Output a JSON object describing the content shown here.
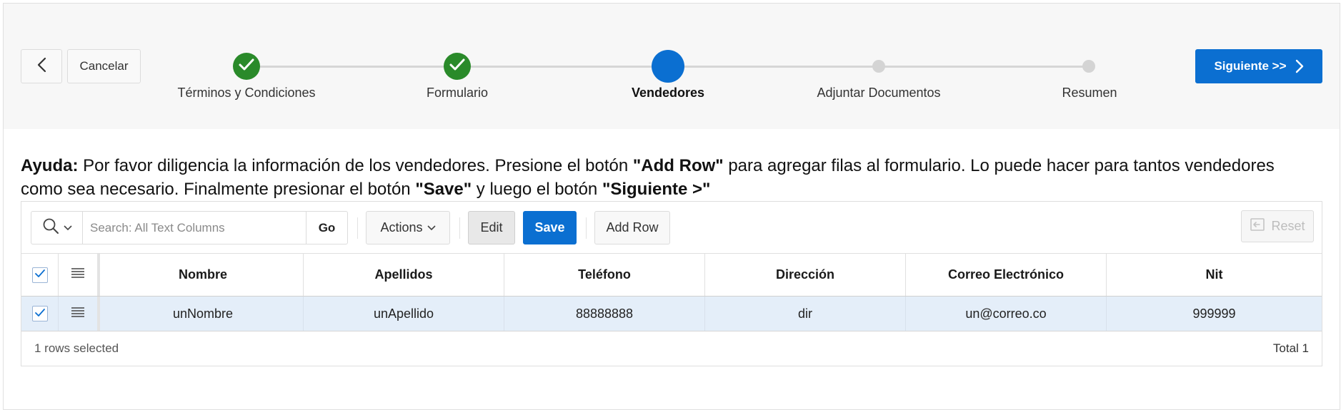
{
  "header": {
    "back_icon": "chevron-left-icon",
    "cancel_label": "Cancelar",
    "next_label": "Siguiente >>",
    "next_icon": "chevron-right-icon",
    "accent_color": "#0b6fd1",
    "done_color": "#2a8a2a"
  },
  "wizard": {
    "steps": [
      {
        "label": "Términos y Condiciones",
        "state": "done"
      },
      {
        "label": "Formulario",
        "state": "done"
      },
      {
        "label": "Vendedores",
        "state": "current"
      },
      {
        "label": "Adjuntar Documentos",
        "state": "future"
      },
      {
        "label": "Resumen",
        "state": "future"
      }
    ]
  },
  "help": {
    "prefix": "Ayuda:",
    "t1": " Por favor diligencia la información de los vendedores. Presione el botón ",
    "b1": "\"Add Row\"",
    "t2": " para agregar filas al formulario. Lo puede hacer para tantos vendedores como sea necesario. Finalmente presionar el botón ",
    "b2": "\"Save\"",
    "t3": " y luego el botón ",
    "b3": "\"Siguiente >\""
  },
  "toolbar": {
    "search_placeholder": "Search: All Text Columns",
    "go_label": "Go",
    "actions_label": "Actions",
    "edit_label": "Edit",
    "save_label": "Save",
    "add_row_label": "Add Row",
    "reset_label": "Reset"
  },
  "table": {
    "columns": [
      "Nombre",
      "Apellidos",
      "Teléfono",
      "Dirección",
      "Correo Electrónico",
      "Nit"
    ],
    "rows": [
      [
        "unNombre",
        "unApellido",
        "88888888",
        "dir",
        "un@correo.co",
        "999999"
      ]
    ]
  },
  "footer": {
    "selected_text": "1 rows selected",
    "total_text": "Total 1"
  }
}
